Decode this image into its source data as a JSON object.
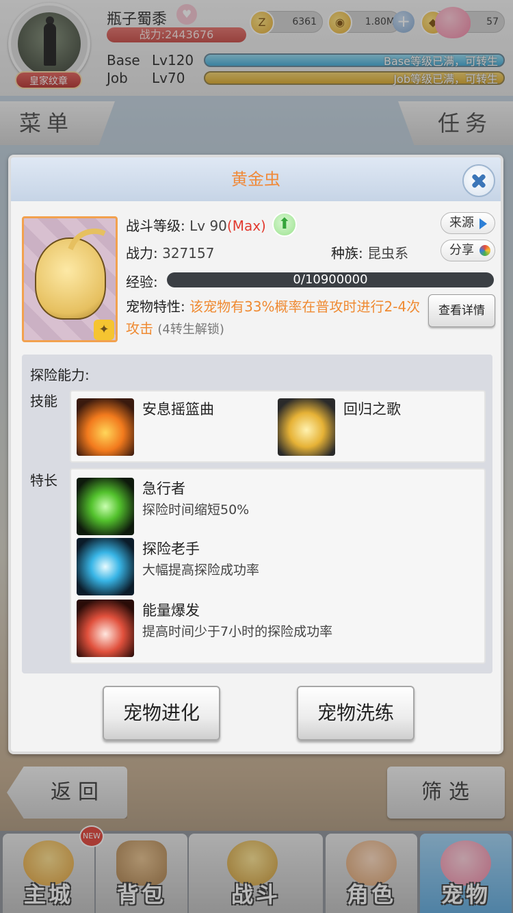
{
  "header": {
    "badge": "皇家纹章",
    "player_name": "瓶子蜀黍",
    "power": "战力:2443676",
    "currency": [
      {
        "icon": "zeny-icon",
        "glyph": "Z",
        "value": "6361"
      },
      {
        "icon": "gold-icon",
        "glyph": "◉",
        "value": "1.80M"
      },
      {
        "icon": "diamond-icon",
        "glyph": "◆",
        "value": "57"
      }
    ],
    "base_label": "Base",
    "base_level": "Lv120",
    "base_exp_text": "Base等级已满，可转生",
    "job_label": "Job",
    "job_level": "Lv70",
    "job_exp_text": "Job等级已满，可转生"
  },
  "side_tabs": {
    "menu": "菜单",
    "task": "任务"
  },
  "popup": {
    "title": "黄金虫",
    "battle_level_label": "战斗等级: ",
    "battle_level_value": "Lv 90",
    "battle_level_max": "(Max)",
    "power_label": "战力: ",
    "power_value": "327157",
    "race_label": "种族: ",
    "race_value": "昆虫系",
    "source_btn": "来源",
    "share_btn": "分享",
    "exp_label": "经验: ",
    "exp_value": "0/10900000",
    "trait_label": "宠物特性: ",
    "trait_text": "该宠物有33%概率在普攻时进行2-4次攻击",
    "trait_note": "(4转生解锁)",
    "detail_btn": "查看详情",
    "adventure_title": "探险能力:",
    "skills_label": "技能",
    "skills": [
      {
        "name": "安息摇篮曲"
      },
      {
        "name": "回归之歌"
      }
    ],
    "specialty_label": "特长",
    "specialties": [
      {
        "name": "急行者",
        "desc": "探险时间缩短50%"
      },
      {
        "name": "探险老手",
        "desc": "大幅提高探险成功率"
      },
      {
        "name": "能量爆发",
        "desc": "提高时间少于7小时的探险成功率"
      }
    ],
    "evolve_btn": "宠物进化",
    "refine_btn": "宠物洗练"
  },
  "bottom": {
    "back_btn": "返回",
    "filter_btn": "筛选",
    "nav": [
      {
        "label": "主城",
        "badge": "NEW"
      },
      {
        "label": "背包"
      },
      {
        "label": "战斗"
      },
      {
        "label": "角色"
      },
      {
        "label": "宠物"
      }
    ]
  },
  "colors": {
    "accent_orange": "#ef8a32",
    "max_red": "#e23b30",
    "base_bar": "#3aa8d6",
    "job_bar": "#d9a624"
  }
}
